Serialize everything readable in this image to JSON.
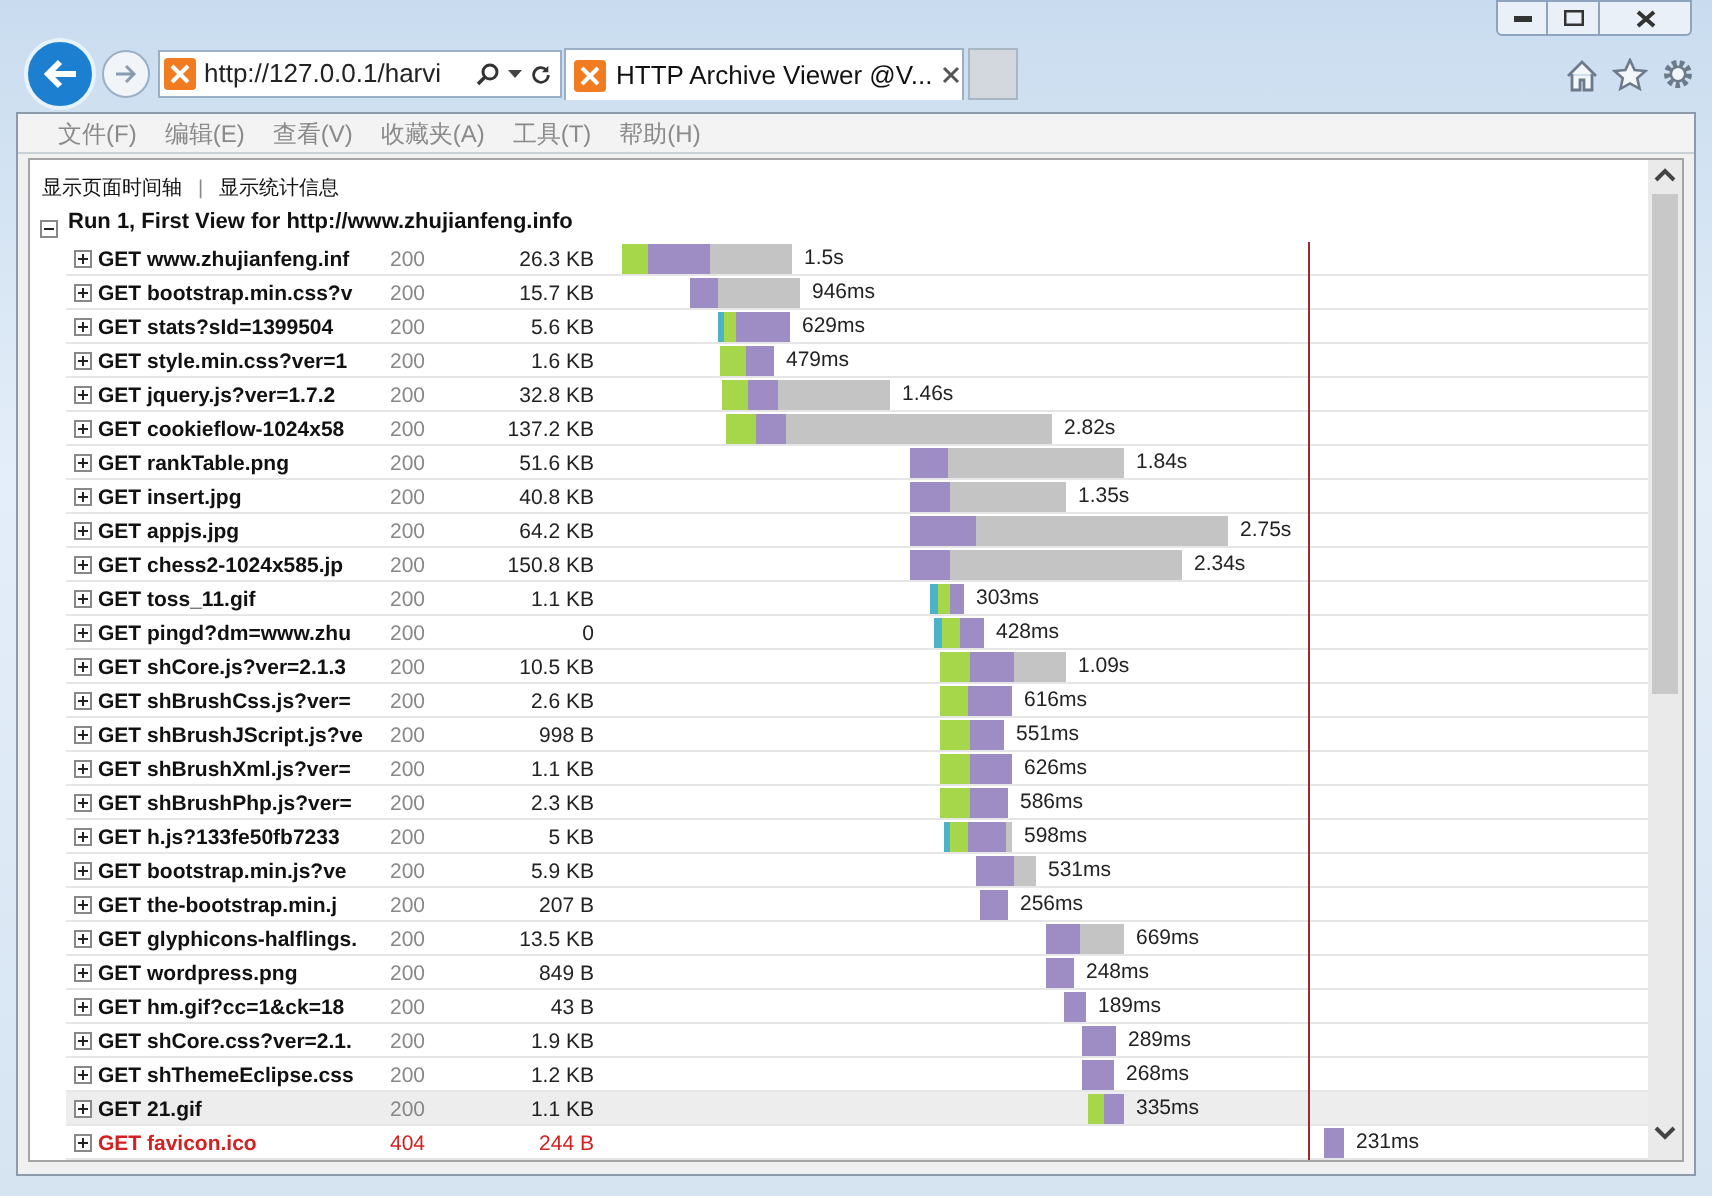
{
  "browser": {
    "address": "http://127.0.0.1/harvi",
    "tab_title": "HTTP Archive Viewer @V..."
  },
  "menu": [
    "文件(F)",
    "编辑(E)",
    "查看(V)",
    "收藏夹(A)",
    "工具(T)",
    "帮助(H)"
  ],
  "toolbar": {
    "links": [
      "显示页面时间轴",
      "显示统计信息"
    ],
    "separator": "|"
  },
  "run": {
    "title": "Run 1, First View for http://www.zhujianfeng.info",
    "expanded": true,
    "requests": [
      {
        "name": "GET www.zhujianfeng.inf",
        "status": "200",
        "size": "26.3 KB",
        "time": "1.5s",
        "expanded": false,
        "selected": false,
        "error": false
      },
      {
        "name": "GET bootstrap.min.css?v",
        "status": "200",
        "size": "15.7 KB",
        "time": "946ms",
        "expanded": false,
        "selected": false,
        "error": false
      },
      {
        "name": "GET stats?sId=1399504",
        "status": "200",
        "size": "5.6 KB",
        "time": "629ms",
        "expanded": false,
        "selected": false,
        "error": false
      },
      {
        "name": "GET style.min.css?ver=1",
        "status": "200",
        "size": "1.6 KB",
        "time": "479ms",
        "expanded": false,
        "selected": false,
        "error": false
      },
      {
        "name": "GET jquery.js?ver=1.7.2",
        "status": "200",
        "size": "32.8 KB",
        "time": "1.46s",
        "expanded": false,
        "selected": false,
        "error": false
      },
      {
        "name": "GET cookieflow-1024x58",
        "status": "200",
        "size": "137.2 KB",
        "time": "2.82s",
        "expanded": false,
        "selected": false,
        "error": false
      },
      {
        "name": "GET rankTable.png",
        "status": "200",
        "size": "51.6 KB",
        "time": "1.84s",
        "expanded": false,
        "selected": false,
        "error": false
      },
      {
        "name": "GET insert.jpg",
        "status": "200",
        "size": "40.8 KB",
        "time": "1.35s",
        "expanded": false,
        "selected": false,
        "error": false
      },
      {
        "name": "GET appjs.jpg",
        "status": "200",
        "size": "64.2 KB",
        "time": "2.75s",
        "expanded": false,
        "selected": false,
        "error": false
      },
      {
        "name": "GET chess2-1024x585.jp",
        "status": "200",
        "size": "150.8 KB",
        "time": "2.34s",
        "expanded": false,
        "selected": false,
        "error": false
      },
      {
        "name": "GET toss_11.gif",
        "status": "200",
        "size": "1.1 KB",
        "time": "303ms",
        "expanded": false,
        "selected": false,
        "error": false
      },
      {
        "name": "GET pingd?dm=www.zhu",
        "status": "200",
        "size": "0",
        "time": "428ms",
        "expanded": false,
        "selected": false,
        "error": false
      },
      {
        "name": "GET shCore.js?ver=2.1.3",
        "status": "200",
        "size": "10.5 KB",
        "time": "1.09s",
        "expanded": false,
        "selected": false,
        "error": false
      },
      {
        "name": "GET shBrushCss.js?ver=",
        "status": "200",
        "size": "2.6 KB",
        "time": "616ms",
        "expanded": false,
        "selected": false,
        "error": false
      },
      {
        "name": "GET shBrushJScript.js?ve",
        "status": "200",
        "size": "998 B",
        "time": "551ms",
        "expanded": false,
        "selected": false,
        "error": false
      },
      {
        "name": "GET shBrushXml.js?ver=",
        "status": "200",
        "size": "1.1 KB",
        "time": "626ms",
        "expanded": false,
        "selected": false,
        "error": false
      },
      {
        "name": "GET shBrushPhp.js?ver=",
        "status": "200",
        "size": "2.3 KB",
        "time": "586ms",
        "expanded": false,
        "selected": false,
        "error": false
      },
      {
        "name": "GET h.js?133fe50fb7233",
        "status": "200",
        "size": "5 KB",
        "time": "598ms",
        "expanded": false,
        "selected": false,
        "error": false
      },
      {
        "name": "GET bootstrap.min.js?ve",
        "status": "200",
        "size": "5.9 KB",
        "time": "531ms",
        "expanded": false,
        "selected": false,
        "error": false
      },
      {
        "name": "GET the-bootstrap.min.j",
        "status": "200",
        "size": "207 B",
        "time": "256ms",
        "expanded": false,
        "selected": false,
        "error": false
      },
      {
        "name": "GET glyphicons-halflings.",
        "status": "200",
        "size": "13.5 KB",
        "time": "669ms",
        "expanded": false,
        "selected": false,
        "error": false
      },
      {
        "name": "GET wordpress.png",
        "status": "200",
        "size": "849 B",
        "time": "248ms",
        "expanded": false,
        "selected": false,
        "error": false
      },
      {
        "name": "GET hm.gif?cc=1&ck=18",
        "status": "200",
        "size": "43 B",
        "time": "189ms",
        "expanded": false,
        "selected": false,
        "error": false
      },
      {
        "name": "GET shCore.css?ver=2.1.",
        "status": "200",
        "size": "1.9 KB",
        "time": "289ms",
        "expanded": false,
        "selected": false,
        "error": false
      },
      {
        "name": "GET shThemeEclipse.css",
        "status": "200",
        "size": "1.2 KB",
        "time": "268ms",
        "expanded": false,
        "selected": false,
        "error": false
      },
      {
        "name": "GET 21.gif",
        "status": "200",
        "size": "1.1 KB",
        "time": "335ms",
        "expanded": false,
        "selected": true,
        "error": false
      },
      {
        "name": "GET favicon.ico",
        "status": "404",
        "size": "244 B",
        "time": "231ms",
        "expanded": false,
        "selected": false,
        "error": true
      }
    ]
  }
}
